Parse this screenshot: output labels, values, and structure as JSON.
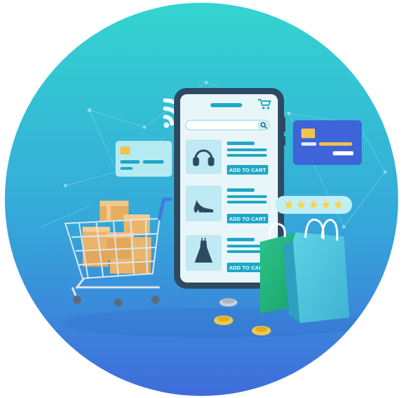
{
  "colors": {
    "circle_top": "#33d2cf",
    "circle_bottom": "#3f6fdc",
    "phone_frame": "#2e4a62",
    "screen": "#e9f6f9",
    "accent": "#1fa8c6",
    "box": "#e9b56d",
    "star": "#ffd23f",
    "bag_green": "#21b37a",
    "bag_blue": "#4fc6dd",
    "coin": "#f3c94a"
  },
  "products": [
    {
      "icon": "headphones-icon",
      "button_label": "ADD TO CART"
    },
    {
      "icon": "high-heel-icon",
      "button_label": "ADD TO CART"
    },
    {
      "icon": "dress-icon",
      "button_label": "ADD TO CART"
    }
  ],
  "rating": {
    "stars": 5,
    "max": 5
  },
  "icons": [
    "cart-icon",
    "search-icon",
    "wifi-icon",
    "credit-card-icon",
    "shopping-cart-icon",
    "shopping-bag-icon",
    "coin-icon",
    "star-icon"
  ]
}
